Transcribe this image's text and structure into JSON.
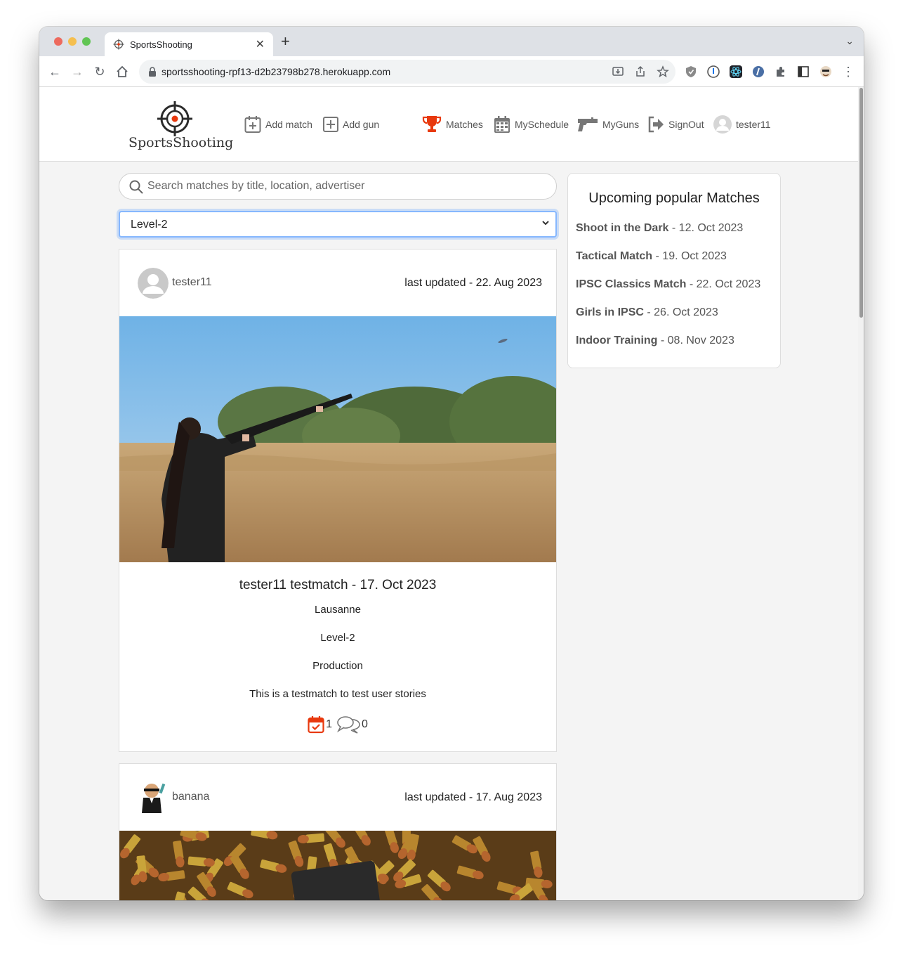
{
  "browser": {
    "tab_title": "SportsShooting",
    "url": "sportsshooting-rpf13-d2b23798b278.herokuapp.com"
  },
  "site": {
    "logo_text": "SportsShooting",
    "nav": {
      "add_match": "Add match",
      "add_gun": "Add gun",
      "matches": "Matches",
      "my_schedule": "MySchedule",
      "my_guns": "MyGuns",
      "sign_out": "SignOut",
      "user": "tester11"
    },
    "accent_color": "#e8390e"
  },
  "filters": {
    "search_placeholder": "Search matches by title, location, advertiser",
    "level_selected": "Level-2"
  },
  "posts": [
    {
      "author": "tester11",
      "updated": "last updated - 22. Aug 2023",
      "title": "tester11 testmatch - 17. Oct 2023",
      "location": "Lausanne",
      "level": "Level-2",
      "division": "Production",
      "description": "This is a testmatch to test user stories",
      "attending_count": "1",
      "comment_count": "0"
    },
    {
      "author": "banana",
      "updated": "last updated - 17. Aug 2023"
    }
  ],
  "sidebar": {
    "title": "Upcoming popular Matches",
    "matches": [
      {
        "name": "Shoot in the Dark",
        "date": " - 12. Oct 2023"
      },
      {
        "name": "Tactical Match",
        "date": " - 19. Oct 2023"
      },
      {
        "name": "IPSC Classics Match",
        "date": " - 22. Oct 2023"
      },
      {
        "name": "Girls in IPSC",
        "date": " - 26. Oct 2023"
      },
      {
        "name": "Indoor Training",
        "date": " - 08. Nov 2023"
      }
    ]
  }
}
